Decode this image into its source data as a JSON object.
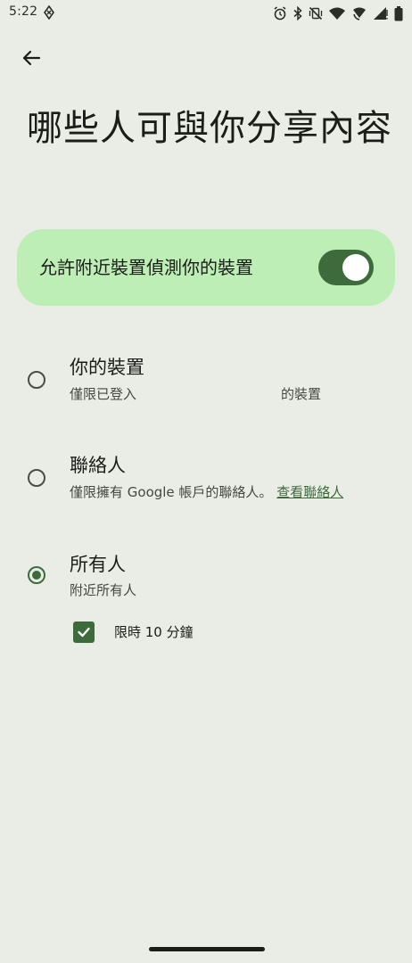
{
  "status_bar": {
    "time": "5:22"
  },
  "header": {
    "title": "哪些人可與你分享內容"
  },
  "visibility_toggle": {
    "label": "允許附近裝置偵測你的裝置",
    "on": true
  },
  "options": [
    {
      "title": "你的裝置",
      "subtitle_prefix": "僅限已登入",
      "subtitle_suffix": "的裝置",
      "selected": false
    },
    {
      "title": "聯絡人",
      "subtitle": "僅限擁有 Google 帳戶的聯絡人。",
      "link": "查看聯絡人",
      "selected": false
    },
    {
      "title": "所有人",
      "subtitle": "附近所有人",
      "selected": true
    }
  ],
  "time_limit": {
    "label": "限時 10 分鐘",
    "checked": true
  },
  "colors": {
    "background": "#e9ede5",
    "accent": "#3e6b3b",
    "card": "#bdeeb5"
  }
}
